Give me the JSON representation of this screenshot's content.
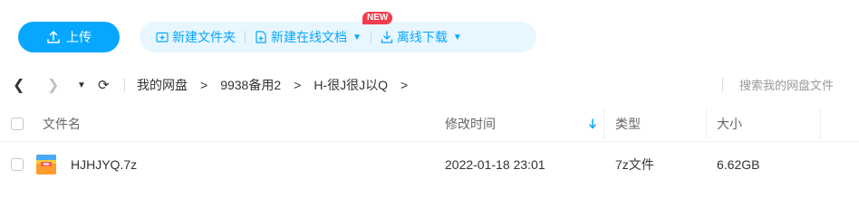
{
  "toolbar": {
    "upload_label": "上传",
    "new_folder_label": "新建文件夹",
    "new_online_doc_label": "新建在线文档",
    "new_badge": "NEW",
    "offline_download_label": "离线下载"
  },
  "nav": {
    "breadcrumb": [
      "我的网盘",
      "9938备用2",
      "H-很J很J以Q"
    ],
    "search_placeholder": "搜索我的网盘文件"
  },
  "table": {
    "columns": [
      "文件名",
      "修改时间",
      "类型",
      "大小"
    ],
    "rows": [
      {
        "name": "HJHJYQ.7z",
        "modified": "2022-01-18 23:01",
        "type": "7z文件",
        "size": "6.62GB"
      }
    ]
  },
  "colors": {
    "accent": "#06a7ff",
    "accent_light": "#e8f6ff",
    "badge": "#f23d4f"
  }
}
